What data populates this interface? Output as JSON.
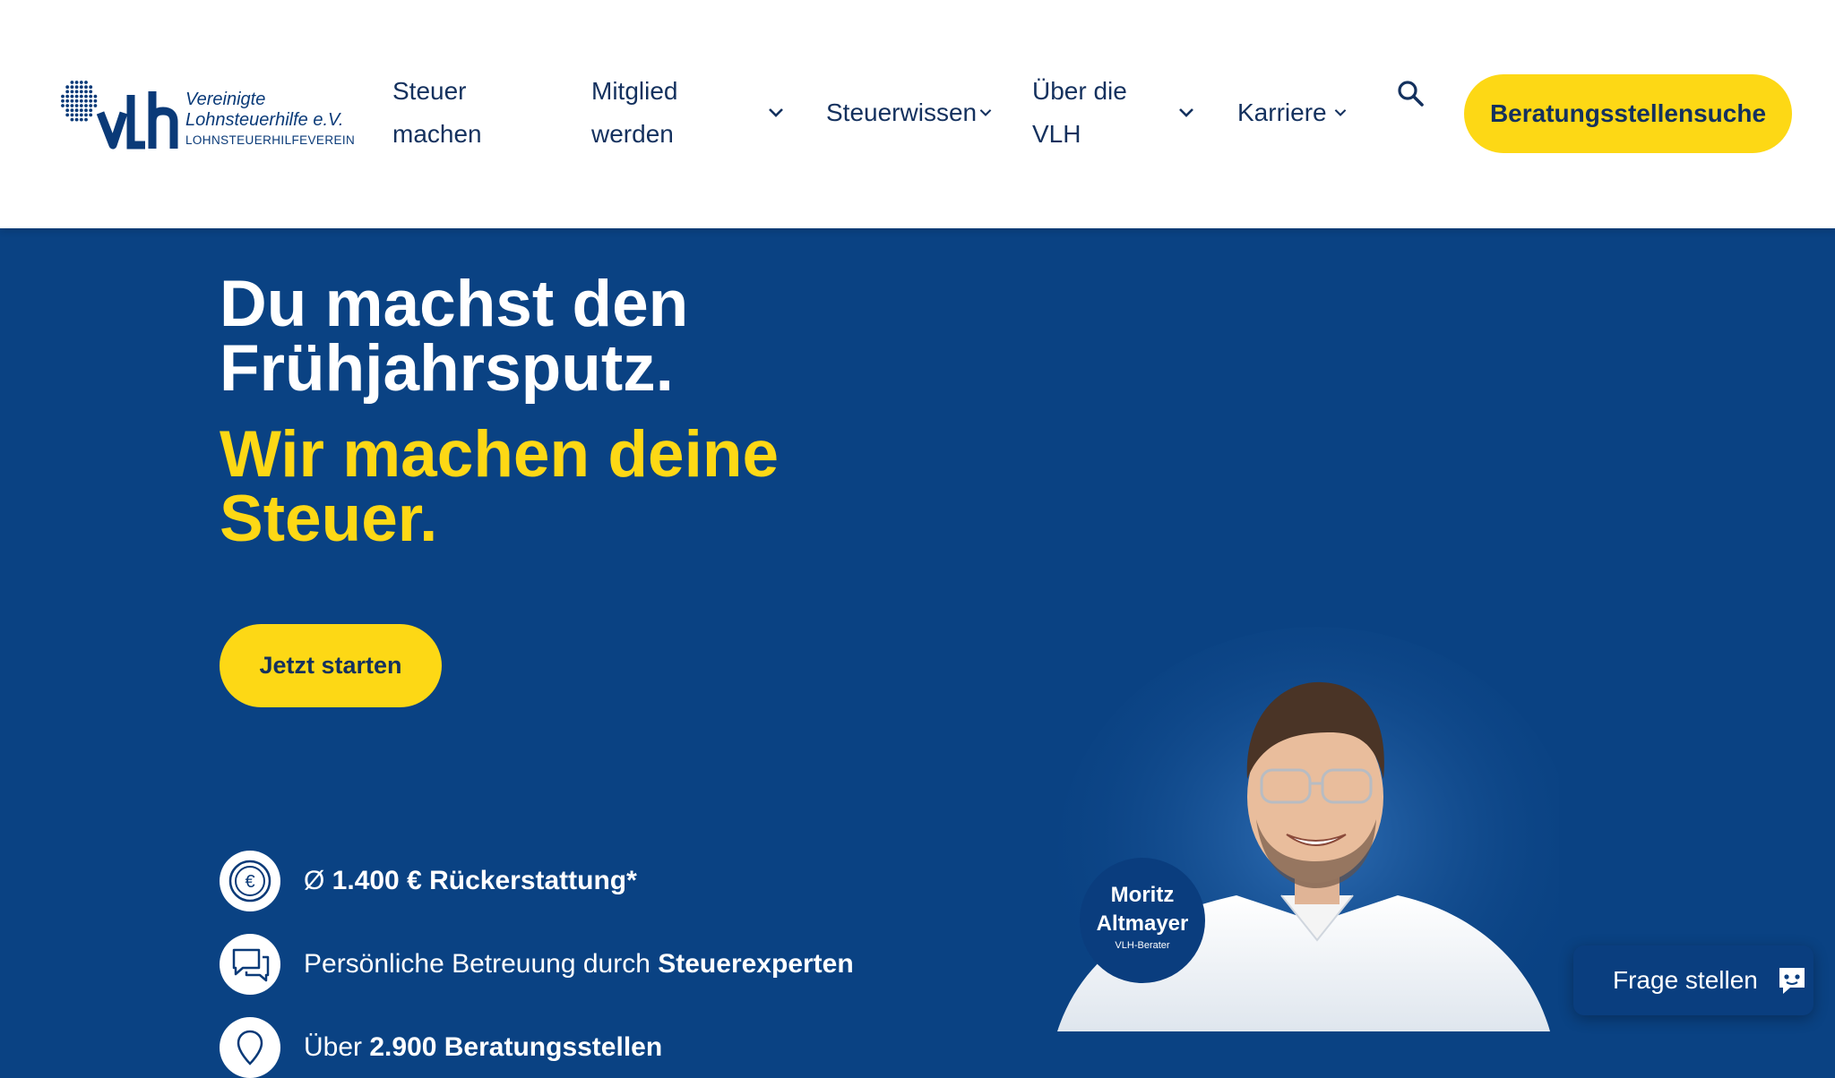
{
  "header": {
    "logo": {
      "line1": "Vereinigte",
      "line2": "Lohnsteuerhilfe e.V.",
      "line3": "LOHNSTEUERHILFEVEREIN",
      "mark": "VLh"
    },
    "nav": [
      {
        "label_line1": "Steuer",
        "label_line2": "machen",
        "dropdown": false
      },
      {
        "label_line1": "Mitglied",
        "label_line2": "werden",
        "dropdown": true
      },
      {
        "label": "Steuerwissen",
        "dropdown": true
      },
      {
        "label_line1": "Über die",
        "label_line2": "VLH",
        "dropdown": true
      },
      {
        "label": "Karriere",
        "dropdown": true
      }
    ],
    "search_icon": "search-icon",
    "cta_label": "Beratungsstellensuche"
  },
  "hero": {
    "headline_line1": "Du machst den",
    "headline_line2": "Frühjahrsputz.",
    "subline_line1": "Wir machen deine",
    "subline_line2": "Steuer.",
    "start_button": "Jetzt starten",
    "features": [
      {
        "icon": "euro-coin-icon",
        "prefix": "Ø ",
        "bold": "1.400 € Rückerstattung*",
        "suffix": ""
      },
      {
        "icon": "chat-bubbles-icon",
        "prefix": "Persönliche Betreuung durch ",
        "bold": "Steuerexperten",
        "suffix": ""
      },
      {
        "icon": "location-icon",
        "prefix": "Über ",
        "bold": "2.900 Beratungsstellen",
        "suffix": ""
      }
    ]
  },
  "advisor": {
    "first_name": "Moritz",
    "last_name": "Altmayer",
    "role": "VLH-Berater"
  },
  "chat_widget": {
    "label": "Frage stellen",
    "icon": "chat-bot-icon"
  },
  "colors": {
    "primary_blue": "#0a4283",
    "accent_yellow": "#fdd815",
    "nav_text": "#14315e"
  }
}
